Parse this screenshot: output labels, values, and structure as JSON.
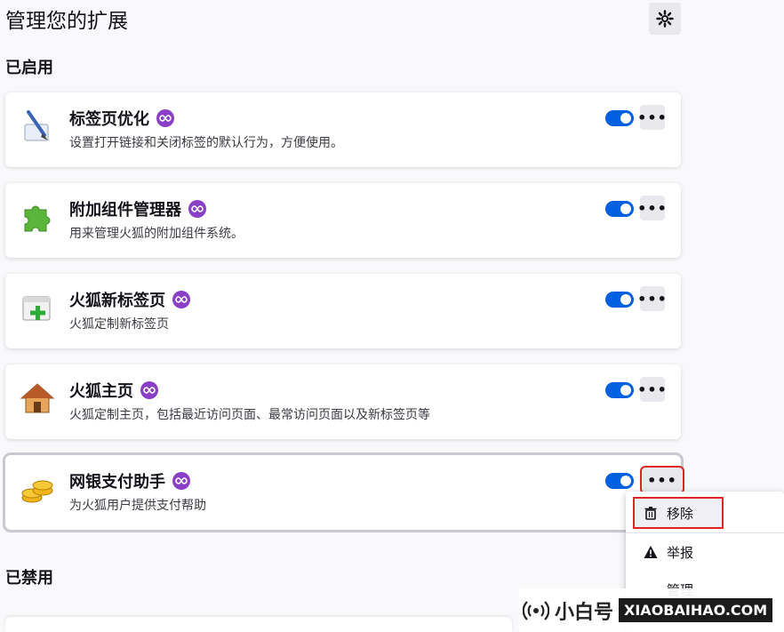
{
  "page": {
    "title": "管理您的扩展",
    "settings_icon": "gear-icon"
  },
  "sections": {
    "enabled_title": "已启用",
    "disabled_title": "已禁用"
  },
  "extensions": [
    {
      "name": "标签页优化",
      "desc": "设置打开链接和关闭标签的默认行为，方便使用。",
      "icon": "tab-brush-icon",
      "enabled": true
    },
    {
      "name": "附加组件管理器",
      "desc": "用来管理火狐的附加组件系统。",
      "icon": "puzzle-icon",
      "enabled": true
    },
    {
      "name": "火狐新标签页",
      "desc": "火狐定制新标签页",
      "icon": "new-tab-icon",
      "enabled": true
    },
    {
      "name": "火狐主页",
      "desc": "火狐定制主页，包括最近访问页面、最常访问页面以及新标签页等",
      "icon": "home-icon",
      "enabled": true
    },
    {
      "name": "网银支付助手",
      "desc": "为火狐用户提供支付帮助",
      "icon": "coins-icon",
      "enabled": true
    }
  ],
  "more_label": "•••",
  "menu": {
    "remove": "移除",
    "report": "举报",
    "manage": "管理"
  },
  "watermark": {
    "cn": "小白号",
    "en": "XIAOBAIHAO.COM"
  },
  "colors": {
    "accent": "#0060df",
    "badge": "#8a3fc7",
    "highlight": "#e02424"
  }
}
